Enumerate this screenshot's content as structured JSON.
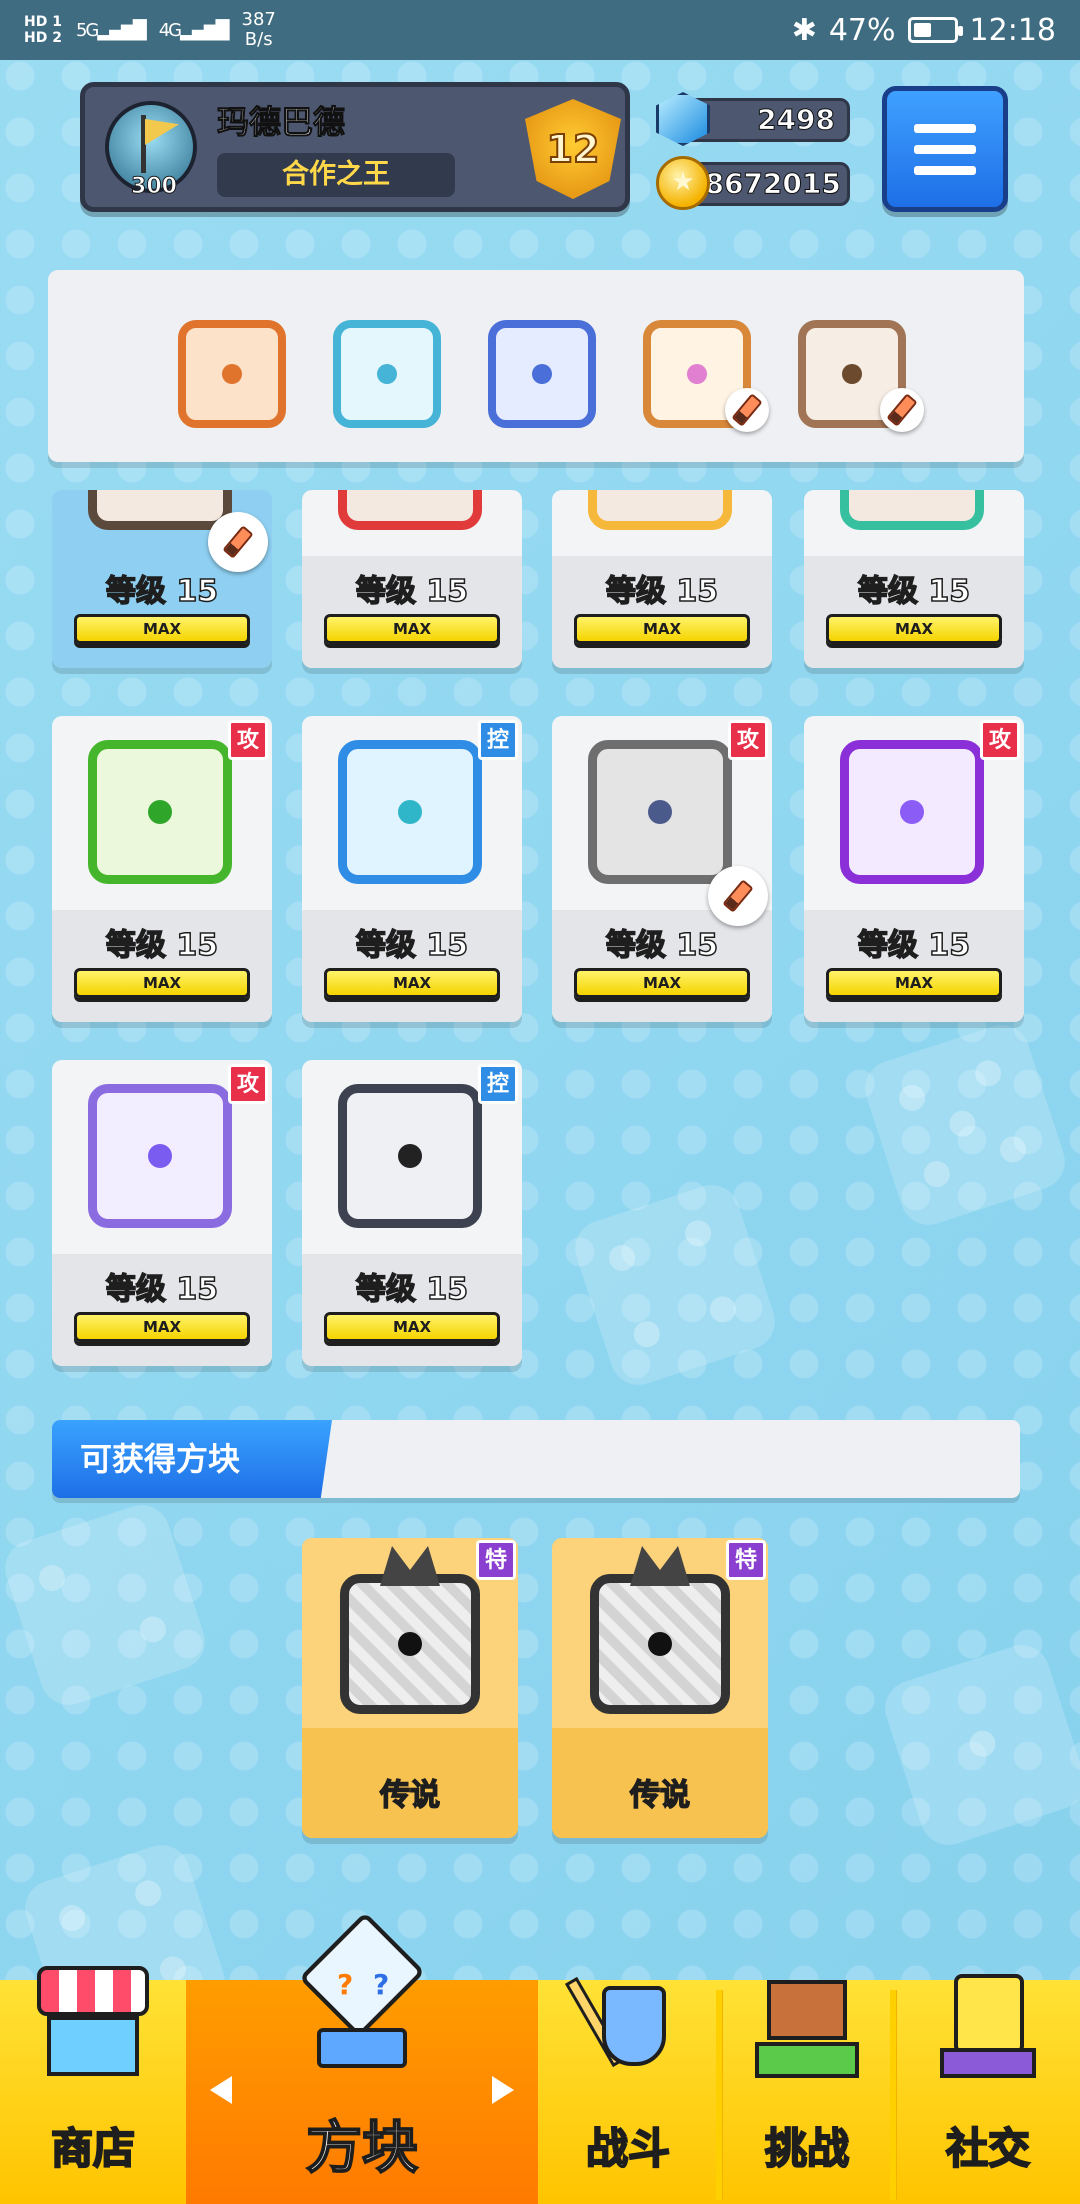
{
  "status_bar": {
    "sim1": "HD 1",
    "sim2": "HD 2",
    "network1": "5G",
    "network2": "4G",
    "speed_value": "387",
    "speed_unit": "B/s",
    "bluetooth_icon": "bluetooth-icon",
    "battery": "47%",
    "battery_level": 0.47,
    "time": "12:18"
  },
  "profile": {
    "name": "玛德巴德",
    "title": "合作之王",
    "avatar_level": "300",
    "rank": "12"
  },
  "currency": {
    "gems": "2498",
    "coins": "18672015"
  },
  "deck": [
    {
      "border": "#e0742c",
      "fill": "#fbe2c8",
      "dot": "#e0742c",
      "edit": false
    },
    {
      "border": "#45b4d6",
      "fill": "#e4f7fd",
      "dot": "#45b4d6",
      "edit": false
    },
    {
      "border": "#4a6fd8",
      "fill": "#e5ecff",
      "dot": "#4a6fd8",
      "edit": false
    },
    {
      "border": "#d9883a",
      "fill": "#fff3e3",
      "dot": "#e17fd0",
      "edit": true
    },
    {
      "border": "#a07454",
      "fill": "#f6ede4",
      "dot": "#6b4a2e",
      "edit": true
    }
  ],
  "dice_list": {
    "row_partial": [
      {
        "level": "等级 15",
        "max": "MAX",
        "border": "#5b4a3b",
        "selected": true,
        "edit": true
      },
      {
        "level": "等级 15",
        "max": "MAX",
        "border": "#e03a3a",
        "selected": false,
        "edit": false
      },
      {
        "level": "等级 15",
        "max": "MAX",
        "border": "#f5b83a",
        "selected": false,
        "edit": false
      },
      {
        "level": "等级 15",
        "max": "MAX",
        "border": "#37c0a0",
        "selected": false,
        "edit": false
      }
    ],
    "row_full": [
      {
        "level": "等级 15",
        "max": "MAX",
        "tag": "攻",
        "tag_type": "attack",
        "border": "#45b52b",
        "fill": "#ecf8dc",
        "dot": "#2fa52a"
      },
      {
        "level": "等级 15",
        "max": "MAX",
        "tag": "控",
        "tag_type": "control",
        "border": "#2f8de6",
        "fill": "#e0f4ff",
        "dot": "#2fb6c9"
      },
      {
        "level": "等级 15",
        "max": "MAX",
        "tag": "攻",
        "tag_type": "attack",
        "border": "#6e6e6e",
        "fill": "#e4e4e4",
        "dot": "#4a5a8a",
        "edit": true
      },
      {
        "level": "等级 15",
        "max": "MAX",
        "tag": "攻",
        "tag_type": "attack",
        "border": "#8b2fd8",
        "fill": "#f3eaff",
        "dot": "#8b5cf6"
      }
    ],
    "row_last": [
      {
        "level": "等级 15",
        "max": "MAX",
        "tag": "攻",
        "tag_type": "attack",
        "border": "#8b6be0",
        "fill": "#f2eeff",
        "dot": "#7b5cf0"
      },
      {
        "level": "等级 15",
        "max": "MAX",
        "tag": "控",
        "tag_type": "control",
        "border": "#3d4250",
        "fill": "#eef0f3",
        "dot": "#222"
      }
    ]
  },
  "obtainable": {
    "header": "可获得方块",
    "items": [
      {
        "rarity": "传说",
        "tag": "特"
      },
      {
        "rarity": "传说",
        "tag": "特"
      }
    ]
  },
  "nav": {
    "shop": "商店",
    "dice": "方块",
    "battle": "战斗",
    "challenge": "挑战",
    "social": "社交"
  }
}
